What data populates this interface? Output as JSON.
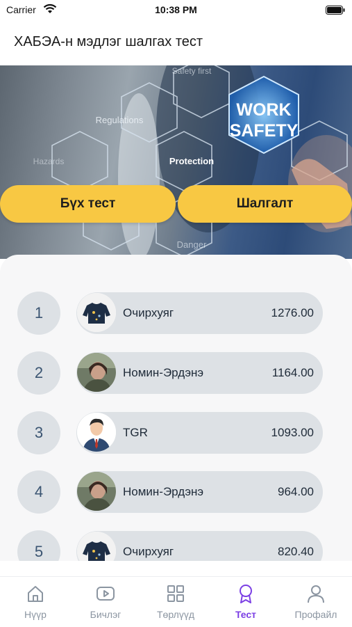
{
  "status_bar": {
    "carrier": "Carrier",
    "time": "10:38 PM"
  },
  "header": {
    "title": "ХАБЭА-н мэдлэг шалгах тест"
  },
  "banner": {
    "word_safety_1": "WORK",
    "word_safety_2": "SAFETY",
    "labels": [
      "Regulations",
      "Protection",
      "Safety first",
      "Hazards",
      "Danger"
    ]
  },
  "buttons": {
    "all_tests": "Бүх тест",
    "exam": "Шалгалт"
  },
  "leaderboard": [
    {
      "rank": "1",
      "name": "Очирхуяг",
      "score": "1276.00",
      "avatar": "sweater-avatar"
    },
    {
      "rank": "2",
      "name": "Номин-Эрдэнэ",
      "score": "1164.00",
      "avatar": "photo-avatar"
    },
    {
      "rank": "3",
      "name": "TGR",
      "score": "1093.00",
      "avatar": "businessman-avatar"
    },
    {
      "rank": "4",
      "name": "Номин-Эрдэнэ",
      "score": "964.00",
      "avatar": "photo-avatar"
    },
    {
      "rank": "5",
      "name": "Очирхуяг",
      "score": "820.40",
      "avatar": "sweater-avatar"
    }
  ],
  "tabs": [
    {
      "label": "Нүүр",
      "icon": "home-icon",
      "active": false
    },
    {
      "label": "Бичлэг",
      "icon": "video-icon",
      "active": false
    },
    {
      "label": "Төрлүүд",
      "icon": "grid-icon",
      "active": false
    },
    {
      "label": "Тест",
      "icon": "badge-icon",
      "active": true
    },
    {
      "label": "Профайл",
      "icon": "profile-icon",
      "active": false
    }
  ],
  "colors": {
    "accent": "#7b3fe4",
    "button": "#f8c843",
    "row_bg": "#dde1e5",
    "rank_text": "#3b5572"
  }
}
